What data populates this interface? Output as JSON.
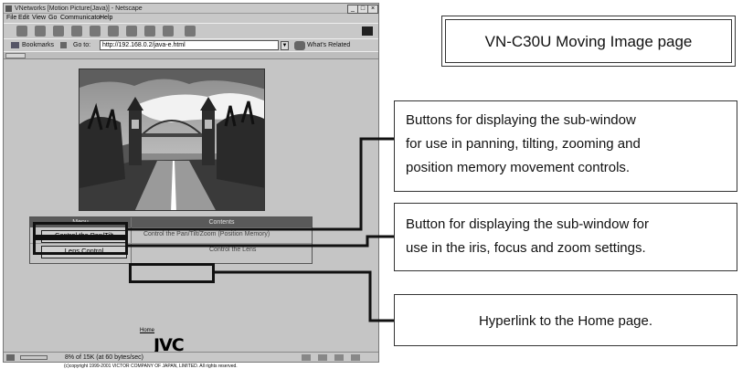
{
  "browser": {
    "title": "VNetworks [Motion Picture(Java)] - Netscape",
    "menu": [
      "File",
      "Edit",
      "View",
      "Go",
      "Communicator",
      "Help"
    ],
    "bookmarks_label": "Bookmarks",
    "goto_label": "Go to:",
    "url": "http://192.168.0.2/java-e.html",
    "whats_related": "What's Related",
    "status_text": "8% of 15K (at 60 bytes/sec)"
  },
  "page": {
    "menu_header": "Menu",
    "contents_header": "Contents",
    "buttons": {
      "pan_tilt": "Control the Pan/Tilt",
      "lens": "Lens Control"
    },
    "contents_row1": "Control the Pan/Tilt/Zoom (Position Memory)",
    "contents_row2": "Control the Lens",
    "home_link": "Home",
    "logo": "JVC",
    "copyright": "(c)copyright 1999-2001 VICTOR COMPANY OF JAPAN, LIMITED. All rights reserved."
  },
  "callouts": {
    "title": "VN-C30U Moving Image page",
    "pan_tilt_lines": [
      "Buttons for displaying the sub-window",
      "for use in panning, tilting, zooming and",
      "position memory movement controls."
    ],
    "lens_lines": [
      "Button for displaying the sub-window for",
      "use in the iris, focus and zoom settings."
    ],
    "home": "Hyperlink to the Home page."
  }
}
